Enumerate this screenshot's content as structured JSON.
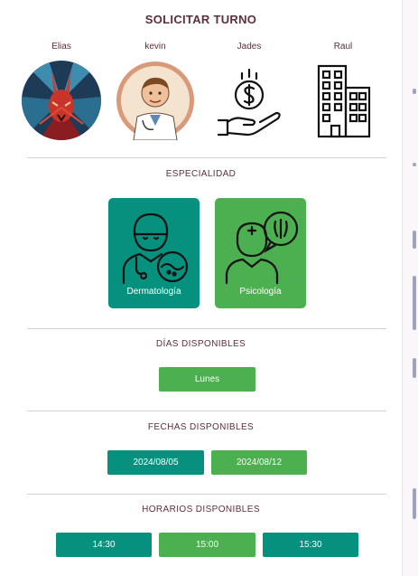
{
  "title": "SOLICITAR TURNO",
  "providers": [
    {
      "name": "Elias",
      "icon": "rabbit-avatar"
    },
    {
      "name": "kevin",
      "icon": "doctor-avatar"
    },
    {
      "name": "Jades",
      "icon": "money-hand-icon"
    },
    {
      "name": "Raul",
      "icon": "building-icon"
    }
  ],
  "specialty": {
    "title": "ESPECIALIDAD",
    "items": [
      {
        "label": "Dermatología",
        "color": "#06917f",
        "icon": "dermatologist-icon"
      },
      {
        "label": "Psicología",
        "color": "#4caf50",
        "icon": "psychologist-icon"
      }
    ]
  },
  "days": {
    "title": "DÍAS DISPONIBLES",
    "items": [
      {
        "label": "Lunes",
        "color": "#4caf50"
      }
    ]
  },
  "dates": {
    "title": "FECHAS DISPONIBLES",
    "items": [
      {
        "label": "2024/08/05",
        "color": "#06917f"
      },
      {
        "label": "2024/08/12",
        "color": "#4caf50"
      }
    ]
  },
  "times": {
    "title": "HORARIOS DISPONIBLES",
    "items": [
      {
        "label": "14:30",
        "color": "#06917f"
      },
      {
        "label": "15:00",
        "color": "#4caf50"
      },
      {
        "label": "15:30",
        "color": "#06917f"
      }
    ]
  }
}
